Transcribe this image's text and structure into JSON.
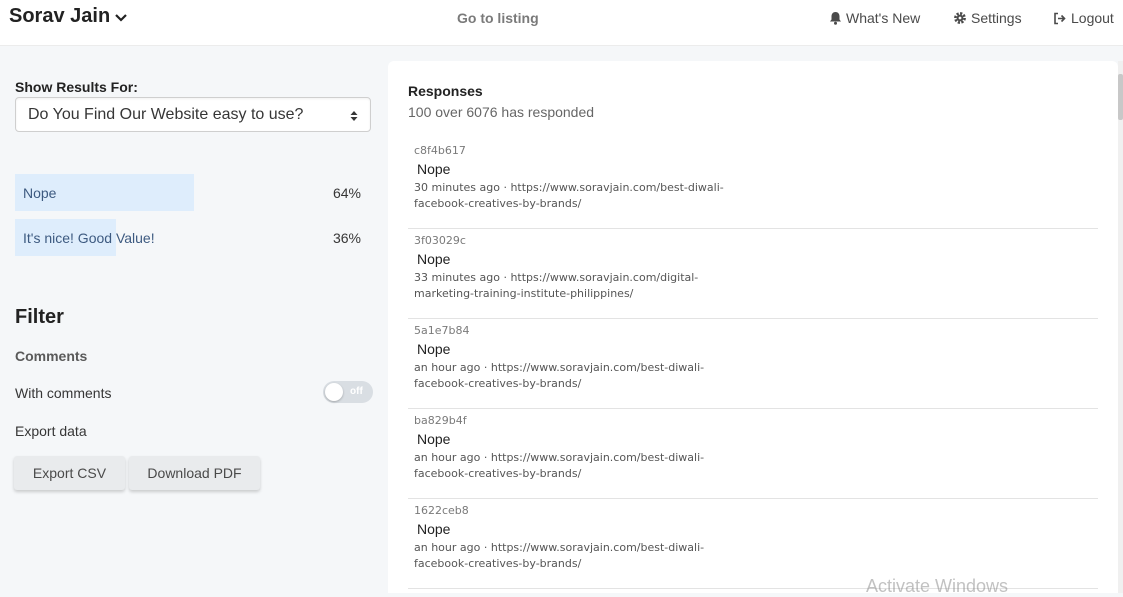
{
  "header": {
    "brand": "Sorav Jain",
    "go_to_listing": "Go to listing",
    "whats_new": "What's New",
    "settings": "Settings",
    "logout": "Logout"
  },
  "sidebar": {
    "show_results_label": "Show Results For:",
    "question_select": "Do You Find Our Website easy to use?",
    "results": [
      {
        "label": "Nope",
        "percent_label": "64%",
        "fraction": 0.64
      },
      {
        "label": "It's nice! Good Value!",
        "percent_label": "36%",
        "fraction": 0.36
      }
    ],
    "filter_title": "Filter",
    "comments_heading": "Comments",
    "with_comments_label": "With comments",
    "toggle_state": "off",
    "export_label": "Export data",
    "export_csv": "Export CSV",
    "download_pdf": "Download PDF"
  },
  "responses": {
    "title": "Responses",
    "summary": "100 over 6076 has responded",
    "items": [
      {
        "id": "c8f4b617",
        "answer": "Nope",
        "meta": "30 minutes ago · https://www.soravjain.com/best-diwali-facebook-creatives-by-brands/"
      },
      {
        "id": "3f03029c",
        "answer": "Nope",
        "meta": "33 minutes ago · https://www.soravjain.com/digital-marketing-training-institute-philippines/"
      },
      {
        "id": "5a1e7b84",
        "answer": "Nope",
        "meta": "an hour ago · https://www.soravjain.com/best-diwali-facebook-creatives-by-brands/"
      },
      {
        "id": "ba829b4f",
        "answer": "Nope",
        "meta": "an hour ago · https://www.soravjain.com/best-diwali-facebook-creatives-by-brands/"
      },
      {
        "id": "1622ceb8",
        "answer": "Nope",
        "meta": "an hour ago · https://www.soravjain.com/best-diwali-facebook-creatives-by-brands/"
      }
    ]
  },
  "watermark": "Activate Windows",
  "colors": {
    "result_bar": "#deedfc",
    "accent_text": "#3d5a80",
    "background": "#f5f7f9"
  }
}
